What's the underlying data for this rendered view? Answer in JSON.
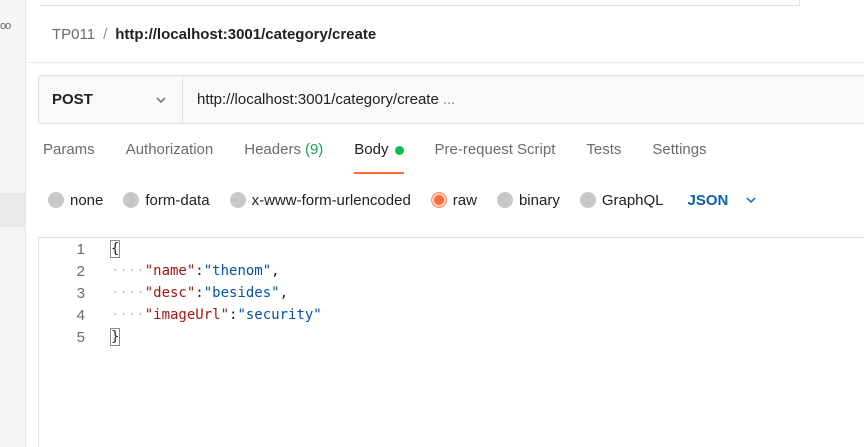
{
  "sidebar": {
    "dots": "oo"
  },
  "breadcrumb": {
    "collection": "TP011",
    "separator": "/",
    "request": "http://localhost:3001/category/create"
  },
  "request": {
    "method": "POST",
    "url": "http://localhost:3001/category/create",
    "url_tail": "..."
  },
  "tabs": [
    {
      "label": "Params"
    },
    {
      "label": "Authorization"
    },
    {
      "label": "Headers",
      "count": "(9)"
    },
    {
      "label": "Body"
    },
    {
      "label": "Pre-request Script"
    },
    {
      "label": "Tests"
    },
    {
      "label": "Settings"
    }
  ],
  "body_types": [
    {
      "label": "none"
    },
    {
      "label": "form-data"
    },
    {
      "label": "x-www-form-urlencoded"
    },
    {
      "label": "raw"
    },
    {
      "label": "binary"
    },
    {
      "label": "GraphQL"
    }
  ],
  "language": "JSON",
  "editor": {
    "lines": [
      {
        "num": "1",
        "open": "{"
      },
      {
        "num": "2",
        "ws": "····",
        "key": "\"name\"",
        "colon": ":",
        "value": "\"thenom\"",
        "comma": ","
      },
      {
        "num": "3",
        "ws": "····",
        "key": "\"desc\"",
        "colon": ":",
        "value": "\"besides\"",
        "comma": ","
      },
      {
        "num": "4",
        "ws": "····",
        "key": "\"imageUrl\"",
        "colon": ":",
        "value": "\"security\""
      },
      {
        "num": "5",
        "close": "}"
      }
    ]
  },
  "colors": {
    "accent": "#ff6c37",
    "body_dot": "#0cbb52",
    "language": "#0d5fb3",
    "headers_count": "#1f9d55"
  }
}
